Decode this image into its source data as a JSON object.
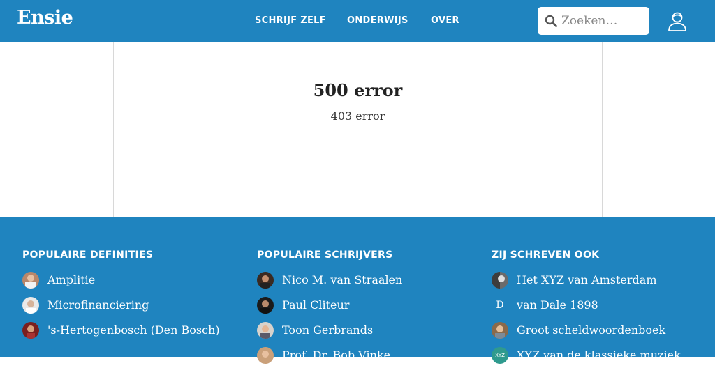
{
  "header": {
    "logo": "Ensie",
    "nav": [
      "SCHRIJF ZELF",
      "ONDERWIJS",
      "OVER"
    ],
    "search_placeholder": "Zoeken…"
  },
  "error": {
    "title": "500 error",
    "subtitle": "403 error"
  },
  "footer": {
    "columns": [
      {
        "title": "POPULAIRE DEFINITIES",
        "items": [
          "Amplitie",
          "Microfinanciering",
          "'s-Hertogenbosch (Den Bosch)"
        ]
      },
      {
        "title": "POPULAIRE SCHRIJVERS",
        "items": [
          "Nico M. van Straalen",
          "Paul Cliteur",
          "Toon Gerbrands",
          "Prof. Dr. Bob Vinke"
        ]
      },
      {
        "title": "ZIJ SCHREVEN OOK",
        "items": [
          "Het XYZ van Amsterdam",
          "van Dale 1898",
          "Groot scheldwoordenboek",
          "XYZ van de klassieke muziek"
        ],
        "avatar_letters": [
          "D",
          "XYZ"
        ]
      }
    ]
  },
  "colors": {
    "brand_blue": "#1f84bf",
    "text_dark": "#222222",
    "border": "#d8d8d8"
  }
}
